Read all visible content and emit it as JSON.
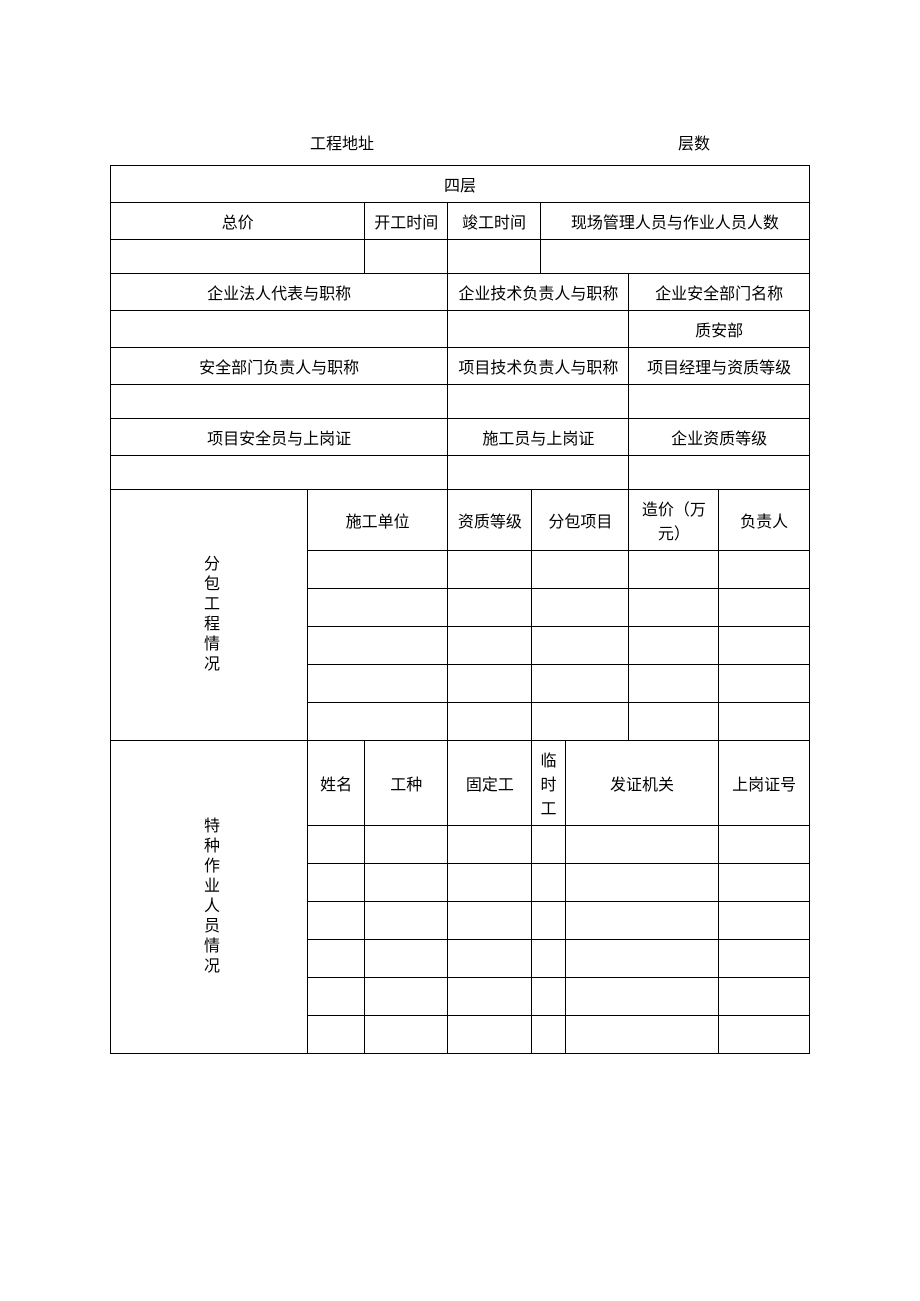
{
  "header": {
    "address_label": "工程地址",
    "floors_label": "层数"
  },
  "row1": {
    "value": "四层"
  },
  "row2": {
    "total_price": "总价",
    "start_date": "开工时间",
    "completion_date": "竣工时间",
    "personnel": "现场管理人员与作业人员人数"
  },
  "row3": {
    "col1": "企业法人代表与职称",
    "col2": "企业技术负责人与职称",
    "col3": "企业安全部门名称",
    "col3_value": "质安部"
  },
  "row4": {
    "col1": "安全部门负责人与职称",
    "col2": "项目技术负责人与职称",
    "col3": "项目经理与资质等级"
  },
  "row5": {
    "col1": "项目安全员与上岗证",
    "col2": "施工员与上岗证",
    "col3": "企业资质等级"
  },
  "subcontract": {
    "label": "分包工程情况",
    "headers": {
      "unit": "施工单位",
      "qualification": "资质等级",
      "project": "分包项目",
      "cost": "造价（万元）",
      "person": "负责人"
    }
  },
  "special": {
    "label": "特种作业人员情况",
    "headers": {
      "name": "姓名",
      "type": "工种",
      "fixed": "固定工",
      "temp": "临时工",
      "agency": "发证机关",
      "cert": "上岗证号"
    }
  }
}
